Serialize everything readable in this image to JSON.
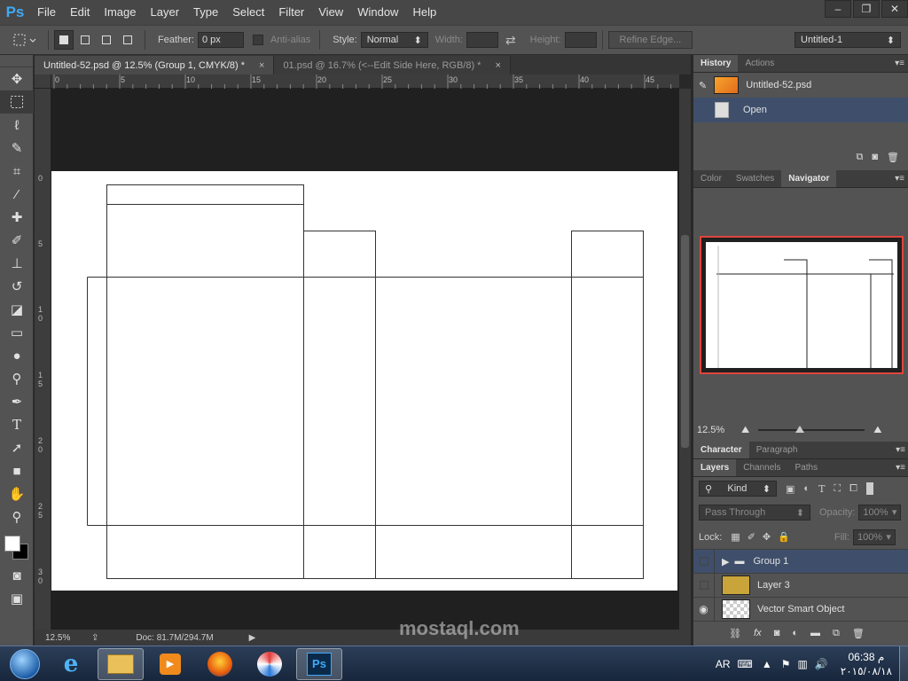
{
  "app": {
    "logo": "Ps",
    "menu": [
      "File",
      "Edit",
      "Image",
      "Layer",
      "Type",
      "Select",
      "Filter",
      "View",
      "Window",
      "Help"
    ],
    "window_controls": [
      "–",
      "❐",
      "✕"
    ]
  },
  "options": {
    "feather_label": "Feather:",
    "feather_value": "0 px",
    "antialias_label": "Anti-alias",
    "style_label": "Style:",
    "style_value": "Normal",
    "width_label": "Width:",
    "height_label": "Height:",
    "refine_edge": "Refine Edge...",
    "workspace": "Untitled-1"
  },
  "tabs": [
    {
      "label": "Untitled-52.psd @ 12.5% (Group 1, CMYK/8) *",
      "close": "×"
    },
    {
      "label": "01.psd @ 16.7% (<--Edit Side Here, RGB/8) *",
      "close": "×"
    }
  ],
  "ruler": {
    "top": [
      "0",
      "5",
      "10",
      "15",
      "20",
      "25",
      "30",
      "35",
      "40",
      "45"
    ],
    "left": [
      "0",
      "5",
      "1 0",
      "1 5",
      "2 0",
      "2 5",
      "3 0"
    ]
  },
  "status": {
    "zoom": "12.5%",
    "doc": "Doc: 81.7M/294.7M"
  },
  "history": {
    "tabs": [
      "History",
      "Actions"
    ],
    "items": [
      {
        "label": "Untitled-52.psd"
      },
      {
        "label": "Open"
      }
    ]
  },
  "navigator": {
    "tabs": [
      "Color",
      "Swatches",
      "Navigator"
    ],
    "zoom": "12.5%"
  },
  "character": {
    "tabs": [
      "Character",
      "Paragraph"
    ]
  },
  "layers": {
    "tabs": [
      "Layers",
      "Channels",
      "Paths"
    ],
    "filter_kind": "Kind",
    "blend_mode": "Pass Through",
    "opacity_label": "Opacity:",
    "opacity_value": "100%",
    "lock_label": "Lock:",
    "fill_label": "Fill:",
    "fill_value": "100%",
    "items": [
      {
        "name": "Group 1"
      },
      {
        "name": "Layer 3"
      },
      {
        "name": "Vector Smart Object"
      }
    ]
  },
  "taskbar": {
    "lang": "AR",
    "time": "06:38 م",
    "date": "٢٠١٥/٠٨/١٨"
  },
  "watermark": {
    "text": "mostaql.com"
  },
  "colors": {
    "accent": "#3fa9f5",
    "selection": "#3f4f6b",
    "navigator_frame": "#e0443d"
  }
}
